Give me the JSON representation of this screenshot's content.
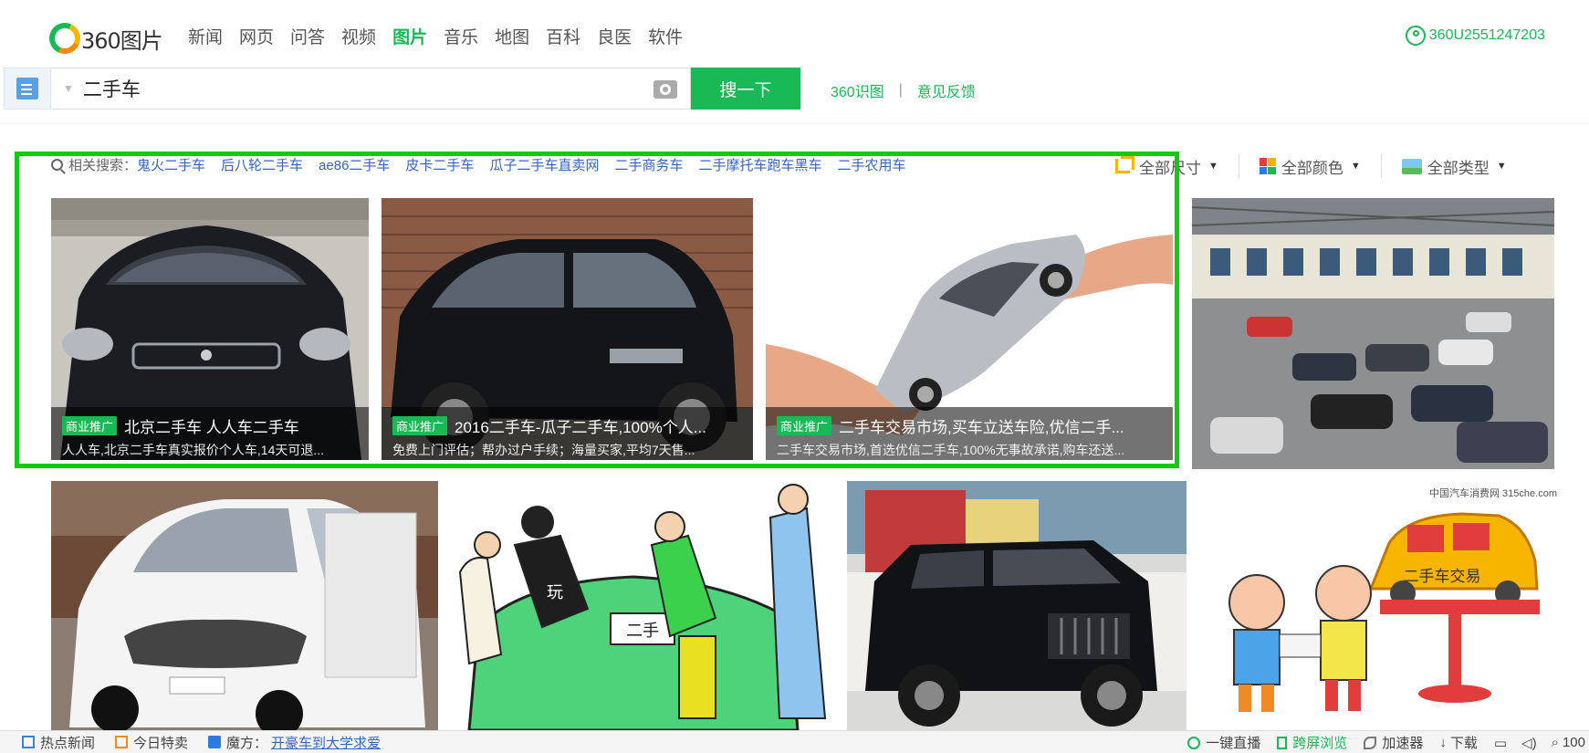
{
  "nav": {
    "logo_text": "360图片",
    "links": [
      "新闻",
      "网页",
      "问答",
      "视频",
      "图片",
      "音乐",
      "地图",
      "百科",
      "良医",
      "软件"
    ],
    "active_index": 4,
    "username": "360U2551247203"
  },
  "search": {
    "query": "二手车",
    "button_label": "搜一下",
    "link_image_recog": "360识图",
    "separator": "|",
    "link_feedback": "意见反馈"
  },
  "related": {
    "label": "相关搜索：",
    "items": [
      "鬼火二手车",
      "后八轮二手车",
      "ae86二手车",
      "皮卡二手车",
      "瓜子二手车直卖网",
      "二手商务车",
      "二手摩托车跑车黑车",
      "二手农用车"
    ]
  },
  "filters": {
    "size": "全部尺寸",
    "color": "全部颜色",
    "type": "全部类型"
  },
  "results": [
    {
      "ad_label": "商业推广",
      "title": "北京二手车 人人车二手车",
      "subtitle": "人人车,北京二手车真实报价个人车,14天可退..."
    },
    {
      "ad_label": "商业推广",
      "title": "2016二手车-瓜子二手车,100%个人...",
      "subtitle": "免费上门评估；帮办过户手续；海量买家,平均7天售..."
    },
    {
      "ad_label": "商业推广",
      "title": "二手车交易市场,买车立送车险,优信二手...",
      "subtitle": "二手车交易市场,首选优信二手车,100%无事故承诺,购车还送..."
    },
    {
      "watermark": "中国汽车消费网 315che.com"
    },
    {
      "text": "二手"
    },
    {
      "text": "玩"
    },
    {
      "text": "二手车交易"
    }
  ],
  "statusbar": {
    "left": [
      "热点新闻",
      "今日特卖",
      "魔方：",
      "开豪车到大学求爱"
    ],
    "right": [
      "一键直播",
      "跨屏浏览",
      "加速器",
      "下载",
      "100"
    ]
  },
  "colors": {
    "brand_green": "#19b955",
    "link_blue": "#3366cc",
    "highlight_green": "#14c814"
  }
}
